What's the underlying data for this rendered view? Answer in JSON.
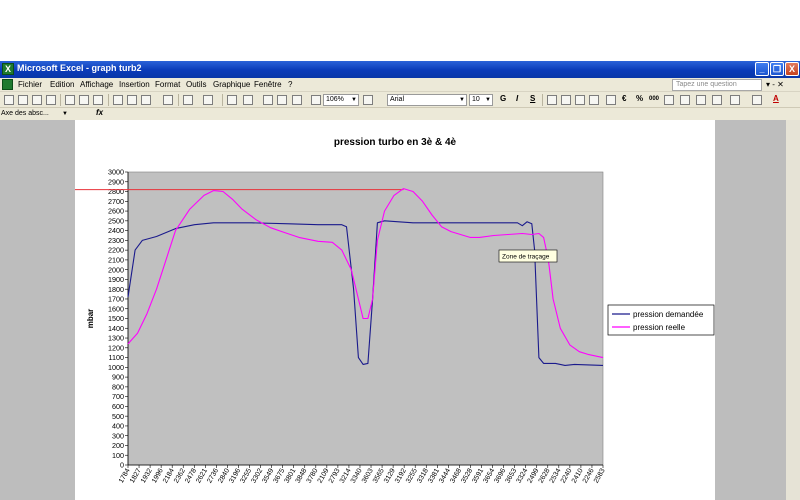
{
  "window": {
    "title": "Microsoft Excel - graph turb2",
    "icon": "excel-app-icon",
    "buttons": {
      "minimize": "_",
      "restore": "❐",
      "close": "X"
    }
  },
  "menubar": {
    "items": [
      "Fichier",
      "Edition",
      "Affichage",
      "Insertion",
      "Format",
      "Outils",
      "Graphique",
      "Fenêtre",
      "?"
    ],
    "help_placeholder": "Tapez une question",
    "right_controls": "▾ - ✕"
  },
  "toolbar": {
    "zoom": "106%",
    "font": "Arial",
    "font_size": "10",
    "bold": "G",
    "italic": "I",
    "underline": "S",
    "percent": "%",
    "thousands": "000",
    "euro": "€",
    "font_color_letter": "A"
  },
  "formulabar": {
    "name_box": "Axe des absc...",
    "fx": "fx"
  },
  "chart": {
    "tooltip": "Zone de traçage",
    "colors": {
      "plot_bg": "#c0c0c0",
      "series1": "#1a1a8c",
      "series2": "#ff00ff",
      "threshold": "#e8333a"
    }
  },
  "chart_data": {
    "type": "line",
    "title": "pression turbo en 3è & 4è",
    "xlabel": "",
    "ylabel": "mbar",
    "ylim": [
      0,
      3000
    ],
    "ytick_step": 100,
    "x_tick_labels": [
      "1784",
      "1827",
      "1932",
      "1996",
      "2184",
      "2362",
      "2478",
      "2621",
      "2736",
      "2840",
      "3196",
      "3255",
      "3302",
      "3549",
      "3675",
      "3801",
      "3848",
      "3780",
      "2109",
      "2793",
      "3214",
      "3340",
      "3603",
      "3565",
      "3129",
      "3192",
      "3255",
      "3318",
      "3381",
      "3444",
      "3468",
      "3528",
      "3591",
      "3654",
      "3696",
      "3653",
      "3324",
      "2499",
      "2628",
      "2534",
      "2240",
      "2410",
      "2246",
      "2583"
    ],
    "x": [
      0,
      2,
      4,
      7,
      10,
      14,
      18,
      22,
      26,
      30,
      34,
      38,
      42,
      46,
      50,
      54,
      56,
      58,
      59,
      60,
      61,
      62,
      63,
      64,
      66,
      68,
      70,
      72,
      74,
      76,
      78,
      80,
      82,
      84,
      86,
      88,
      90,
      92,
      94,
      96,
      98,
      100
    ],
    "series": [
      {
        "name": "pression demandée",
        "points": [
          [
            0,
            1720
          ],
          [
            1.5,
            2200
          ],
          [
            3,
            2300
          ],
          [
            6,
            2340
          ],
          [
            10,
            2420
          ],
          [
            14,
            2460
          ],
          [
            18,
            2480
          ],
          [
            26,
            2480
          ],
          [
            34,
            2470
          ],
          [
            40,
            2460
          ],
          [
            45,
            2460
          ],
          [
            46,
            2440
          ],
          [
            47.5,
            1800
          ],
          [
            48.5,
            1100
          ],
          [
            49.5,
            1030
          ],
          [
            50.5,
            1040
          ],
          [
            51.5,
            1700
          ],
          [
            52.5,
            2480
          ],
          [
            54,
            2500
          ],
          [
            60,
            2480
          ],
          [
            70,
            2480
          ],
          [
            80,
            2480
          ],
          [
            82,
            2480
          ],
          [
            83,
            2450
          ],
          [
            84,
            2490
          ],
          [
            85,
            2470
          ],
          [
            85.6,
            2200
          ],
          [
            86.5,
            1100
          ],
          [
            87.5,
            1040
          ],
          [
            90,
            1040
          ],
          [
            92,
            1020
          ],
          [
            94,
            1030
          ],
          [
            100,
            1020
          ]
        ]
      },
      {
        "name": "pression reelle",
        "points": [
          [
            0,
            1240
          ],
          [
            2,
            1350
          ],
          [
            4,
            1550
          ],
          [
            6,
            1800
          ],
          [
            8,
            2100
          ],
          [
            10,
            2400
          ],
          [
            13,
            2620
          ],
          [
            16,
            2760
          ],
          [
            18,
            2810
          ],
          [
            20,
            2800
          ],
          [
            22,
            2720
          ],
          [
            24,
            2620
          ],
          [
            27,
            2510
          ],
          [
            30,
            2430
          ],
          [
            33,
            2380
          ],
          [
            36,
            2330
          ],
          [
            40,
            2290
          ],
          [
            43,
            2280
          ],
          [
            45,
            2200
          ],
          [
            47,
            2000
          ],
          [
            48.5,
            1700
          ],
          [
            49.5,
            1500
          ],
          [
            50.5,
            1500
          ],
          [
            51.5,
            1700
          ],
          [
            52.5,
            2300
          ],
          [
            54,
            2600
          ],
          [
            56,
            2760
          ],
          [
            58,
            2830
          ],
          [
            60,
            2800
          ],
          [
            62,
            2700
          ],
          [
            64,
            2560
          ],
          [
            66,
            2440
          ],
          [
            68,
            2390
          ],
          [
            70,
            2360
          ],
          [
            72,
            2330
          ],
          [
            74,
            2330
          ],
          [
            77,
            2350
          ],
          [
            80,
            2360
          ],
          [
            83,
            2370
          ],
          [
            85,
            2360
          ],
          [
            86.5,
            2370
          ],
          [
            87.5,
            2330
          ],
          [
            88.5,
            2100
          ],
          [
            89.5,
            1700
          ],
          [
            91,
            1400
          ],
          [
            93,
            1230
          ],
          [
            95,
            1160
          ],
          [
            97,
            1130
          ],
          [
            100,
            1100
          ]
        ]
      }
    ],
    "threshold_line": {
      "y": 2820,
      "from_x_fraction_of_plot": -0.26,
      "to_x_fraction_of_plot": 0.58
    },
    "legend_placement": "right",
    "grid": false
  }
}
